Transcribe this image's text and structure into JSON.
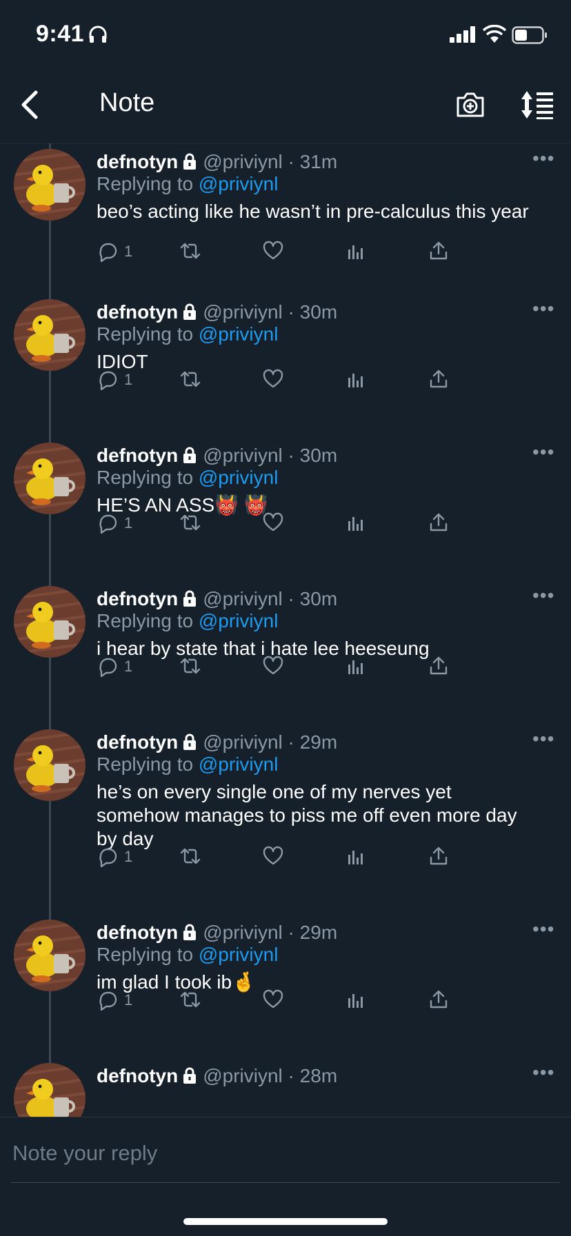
{
  "status_bar": {
    "time": "9:41"
  },
  "nav": {
    "title": "Note"
  },
  "tweets": [
    {
      "name": "defnotyn",
      "handle": "@priviynl",
      "time": "31m",
      "replying_label": "Replying to",
      "replying_to": "@priviynl",
      "text": "beo’s acting like he wasn’t in pre-calculus this year",
      "reply_count": "1"
    },
    {
      "name": "defnotyn",
      "handle": "@priviynl",
      "time": "30m",
      "replying_label": "Replying to",
      "replying_to": "@priviynl",
      "text": "IDIOT",
      "reply_count": "1"
    },
    {
      "name": "defnotyn",
      "handle": "@priviynl",
      "time": "30m",
      "replying_label": "Replying to",
      "replying_to": "@priviynl",
      "text": "HE’S AN ASS👹 👹",
      "reply_count": "1"
    },
    {
      "name": "defnotyn",
      "handle": "@priviynl",
      "time": "30m",
      "replying_label": "Replying to",
      "replying_to": "@priviynl",
      "text": "i hear by state that i hate lee heeseung",
      "reply_count": "1"
    },
    {
      "name": "defnotyn",
      "handle": "@priviynl",
      "time": "29m",
      "replying_label": "Replying to",
      "replying_to": "@priviynl",
      "text": "he’s on every single one of my nerves yet somehow manages to piss me off even more day by day",
      "reply_count": "1"
    },
    {
      "name": "defnotyn",
      "handle": "@priviynl",
      "time": "29m",
      "replying_label": "Replying to",
      "replying_to": "@priviynl",
      "text": "im glad I took ib🤞",
      "reply_count": "1"
    },
    {
      "name": "defnotyn",
      "handle": "@priviynl",
      "time": "28m"
    }
  ],
  "reply_bar": {
    "placeholder": "Note your reply"
  },
  "icons": {
    "status": [
      "headphones-icon",
      "signal-icon",
      "wifi-icon",
      "battery-icon"
    ],
    "nav": [
      "back-chevron-icon",
      "camera-icon",
      "sort-icon"
    ],
    "tweet": [
      "lock-icon",
      "more-icon",
      "reply-icon",
      "retweet-icon",
      "like-icon",
      "analytics-icon",
      "share-icon"
    ]
  },
  "colors": {
    "background": "#15202b",
    "link": "#1d9bf0",
    "muted": "#8b98a5"
  }
}
